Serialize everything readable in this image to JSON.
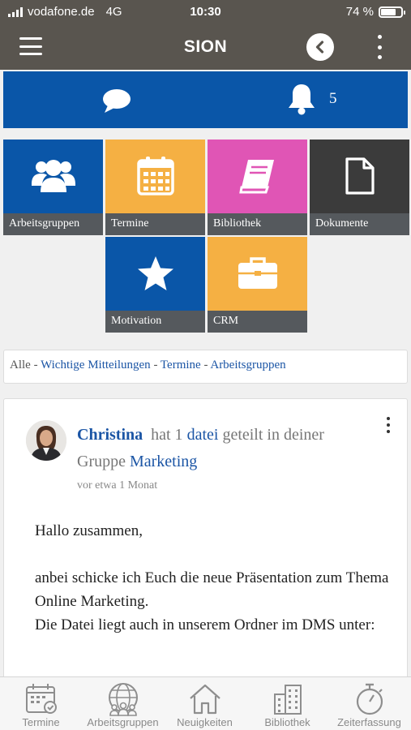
{
  "status": {
    "carrier": "vodafone.de",
    "network": "4G",
    "time": "10:30",
    "battery_text": "74 %",
    "battery_level": 0.74
  },
  "appbar": {
    "title": "SION",
    "back_icon": "chevron-left-icon",
    "menu_icon": "hamburger-icon"
  },
  "notifications": {
    "chat_icon": "chat-bubble-icon",
    "bell_icon": "bell-icon",
    "count": "5"
  },
  "tiles": [
    {
      "label": "Arbeitsgruppen",
      "icon": "users-icon",
      "color": "#0a56a8"
    },
    {
      "label": "Termine",
      "icon": "calendar-icon",
      "color": "#f5b043"
    },
    {
      "label": "Bibliothek",
      "icon": "book-icon",
      "color": "#e055b5"
    },
    {
      "label": "Dokumente",
      "icon": "document-icon",
      "color": "#3b3b3b"
    },
    {
      "label": "Motivation",
      "icon": "star-icon",
      "color": "#0a56a8"
    },
    {
      "label": "CRM",
      "icon": "briefcase-icon",
      "color": "#f5b043"
    }
  ],
  "filter": {
    "all": "Alle",
    "separator": " - ",
    "links": [
      "Wichtige Mitteilungen",
      "Termine",
      "Arbeitsgruppen"
    ]
  },
  "post": {
    "author": "Christina",
    "action_pre": "hat 1",
    "file_link": "datei",
    "action_post": "geteilt in deiner Gruppe",
    "group_link": "Marketing",
    "time": "vor etwa 1 Monat",
    "body": [
      "Hallo zusammen,",
      "anbei schicke ich Euch die neue Präsentation zum Thema Online Marketing.",
      "Die Datei liegt auch in unserem Ordner im DMS unter:"
    ]
  },
  "tabbar": [
    {
      "label": "Termine",
      "icon": "calendar-check-icon"
    },
    {
      "label": "Arbeitsgruppen",
      "icon": "globe-people-icon"
    },
    {
      "label": "Neuigkeiten",
      "icon": "home-icon"
    },
    {
      "label": "Bibliothek",
      "icon": "buildings-icon"
    },
    {
      "label": "Zeiterfassung",
      "icon": "stopwatch-icon"
    }
  ]
}
